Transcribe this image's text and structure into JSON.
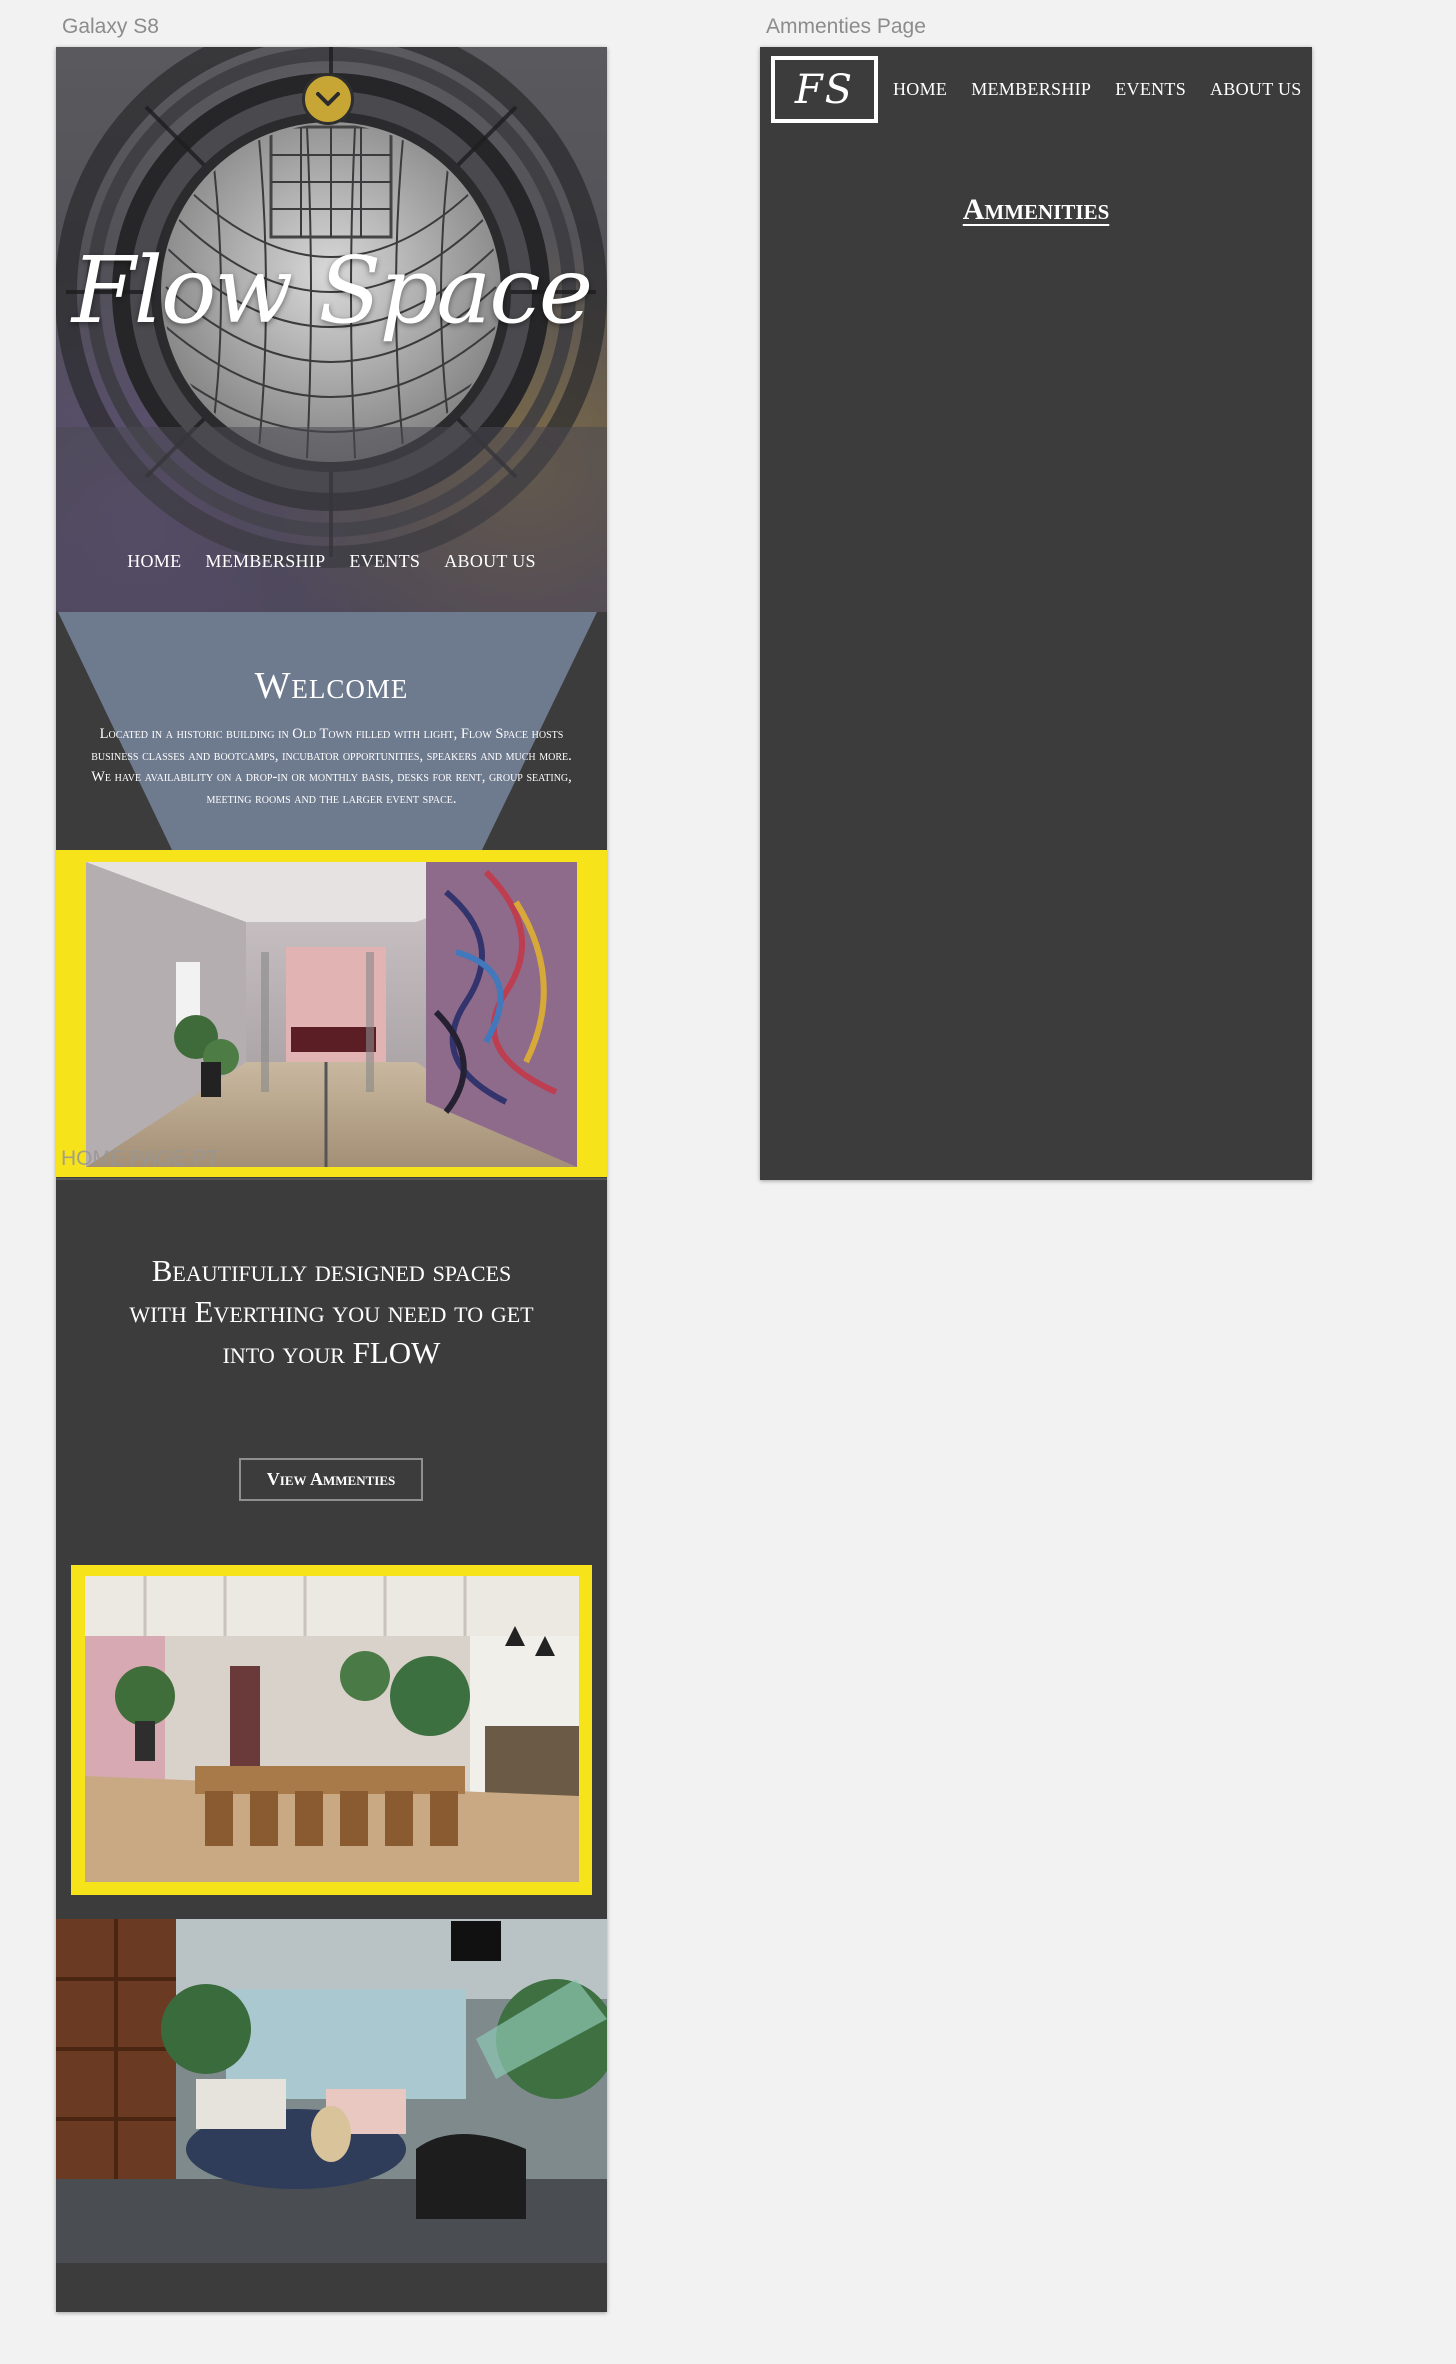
{
  "artboards": {
    "galaxy_label": "Galaxy S8",
    "amenities_label": "Ammenties Page"
  },
  "home": {
    "brand": "Flow Space",
    "nav": [
      "HOME",
      "MEMBERSHIP",
      "EVENTS",
      "ABOUT US"
    ],
    "welcome_title": "Welcome",
    "welcome_body": "Located in a historic building in Old Town filled with light, Flow Space hosts business classes and bootcamps, incubator opportunities, speakers and much more. We have availability on a drop-in or monthly basis, desks for rent, group seating, meeting rooms and the larger event space.",
    "overlay_label": "HOME PAGE PT",
    "tagline": "Beautifully designed spaces with Everthing you need to get into your FLOW",
    "cta": "View Ammenties"
  },
  "amenities": {
    "logo": "FS",
    "nav": [
      "HOME",
      "MEMBERSHIP",
      "EVENTS",
      "ABOUT US"
    ],
    "heading": "Ammenities"
  },
  "icons": {
    "scroll_down": "chevron-down-icon"
  },
  "colors": {
    "frame_bg": "#3c3c3c",
    "canvas_bg": "#f2f2f2",
    "accent_yellow": "#f6e31a",
    "scroll_button": "#c8a636",
    "welcome_trapezoid": "#6e7a8e",
    "text": "#ffffff",
    "label_gray": "#8c8c8c"
  }
}
